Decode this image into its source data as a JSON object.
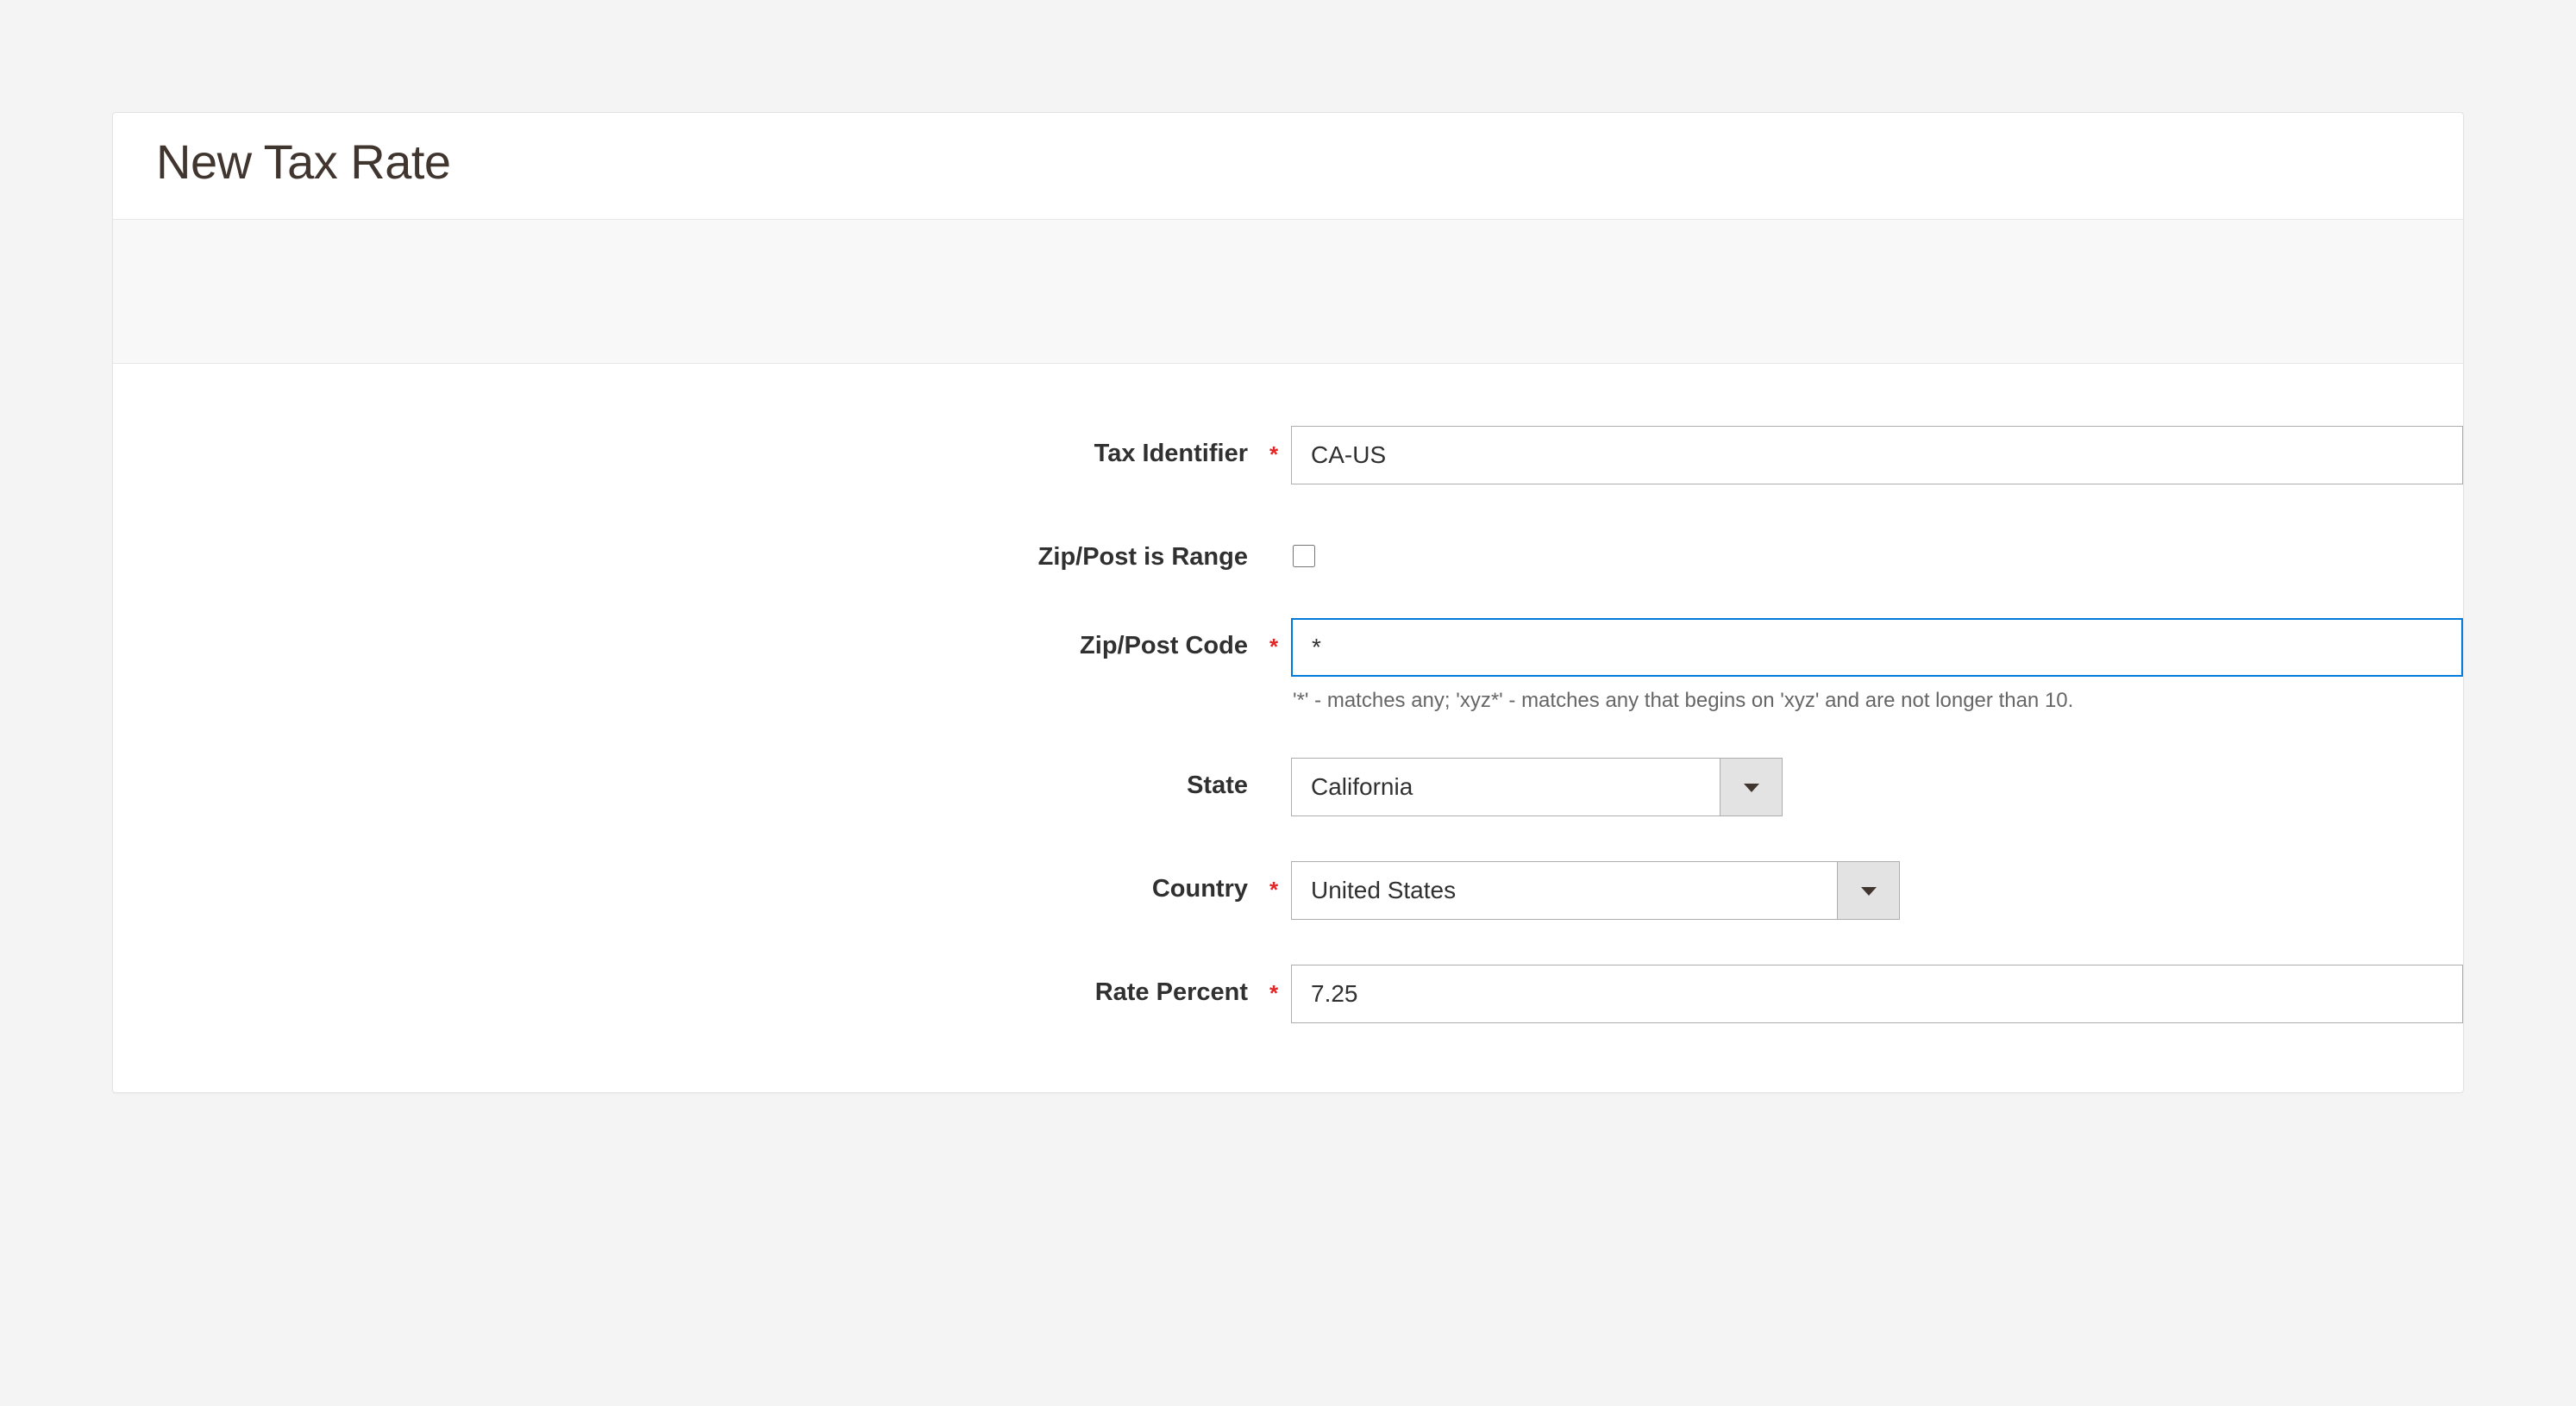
{
  "panel": {
    "title": "New Tax Rate"
  },
  "form": {
    "tax_identifier": {
      "label": "Tax Identifier",
      "value": "CA-US",
      "required": true
    },
    "zip_is_range": {
      "label": "Zip/Post is Range",
      "checked": false,
      "required": false
    },
    "zip_code": {
      "label": "Zip/Post Code",
      "value": "*",
      "required": true,
      "note": "'*' - matches any; 'xyz*' - matches any that begins on 'xyz' and are not longer than 10."
    },
    "state": {
      "label": "State",
      "value": "California",
      "required": false
    },
    "country": {
      "label": "Country",
      "value": "United States",
      "required": true
    },
    "rate_percent": {
      "label": "Rate Percent",
      "value": "7.25",
      "required": true
    }
  },
  "required_symbol": "*"
}
